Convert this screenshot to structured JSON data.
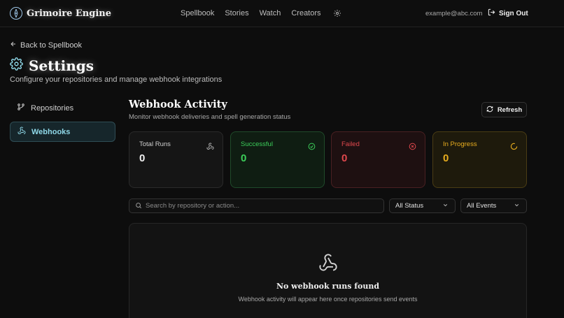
{
  "app": {
    "name": "Grimoire Engine"
  },
  "nav": {
    "items": [
      "Spellbook",
      "Stories",
      "Watch",
      "Creators"
    ]
  },
  "user": {
    "email": "example@abc.com",
    "sign_out_label": "Sign Out"
  },
  "back_link": "Back to Spellbook",
  "page": {
    "title": "Settings",
    "subtitle": "Configure your repositories and manage webhook integrations"
  },
  "sidebar": {
    "items": [
      {
        "label": "Repositories",
        "icon": "git-branch-icon",
        "active": false
      },
      {
        "label": "Webhooks",
        "icon": "webhook-icon",
        "active": true
      }
    ]
  },
  "webhook_activity": {
    "title": "Webhook Activity",
    "subtitle": "Monitor webhook deliveries and spell generation status",
    "refresh_label": "Refresh",
    "stats": {
      "total": {
        "label": "Total Runs",
        "value": "0",
        "icon": "webhook-icon"
      },
      "successful": {
        "label": "Successful",
        "value": "0",
        "icon": "check-circle-icon",
        "color": "#3ccf5a"
      },
      "failed": {
        "label": "Failed",
        "value": "0",
        "icon": "x-circle-icon",
        "color": "#e0484d"
      },
      "in_progress": {
        "label": "In Progress",
        "value": "0",
        "icon": "loader-icon",
        "color": "#e8ad1e"
      }
    },
    "search": {
      "placeholder": "Search by repository or action...",
      "value": ""
    },
    "filters": {
      "status": "All Status",
      "events": "All Events"
    },
    "empty": {
      "title": "No webhook runs found",
      "subtitle": "Webhook activity will appear here once repositories send events"
    }
  },
  "colors": {
    "accent": "#8fd8e8",
    "background": "#0d0d0d"
  }
}
